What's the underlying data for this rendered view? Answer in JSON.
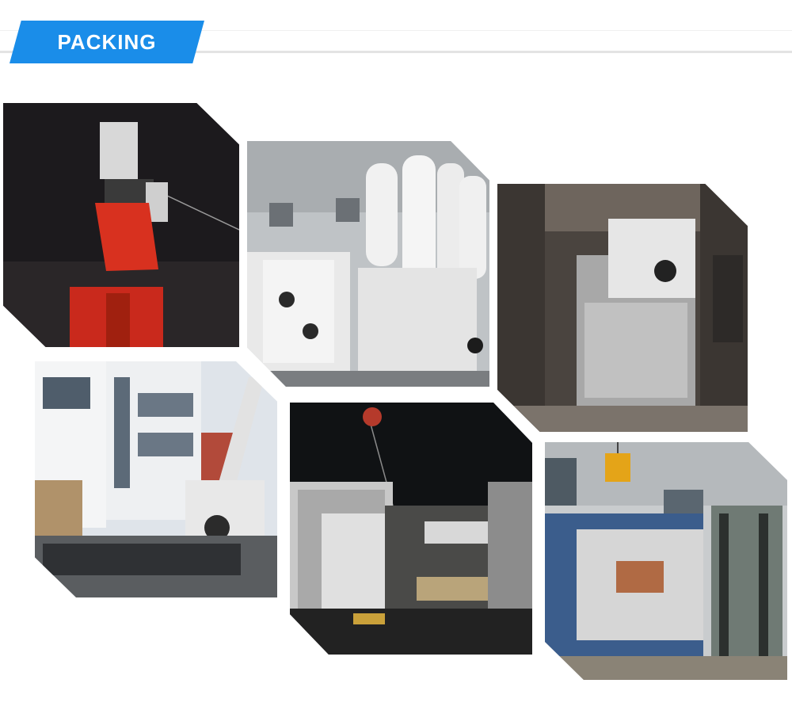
{
  "header": {
    "title": "PACKING"
  },
  "photos": [
    {
      "name": "crane-lifting-machine-night"
    },
    {
      "name": "die-casting-machine-workshop"
    },
    {
      "name": "machine-in-container"
    },
    {
      "name": "truck-crane-loading"
    },
    {
      "name": "container-loading-night"
    },
    {
      "name": "forklift-warehouse-loading"
    }
  ],
  "colors": {
    "accent": "#1a8de9",
    "header_line": "#e3e3e3"
  }
}
